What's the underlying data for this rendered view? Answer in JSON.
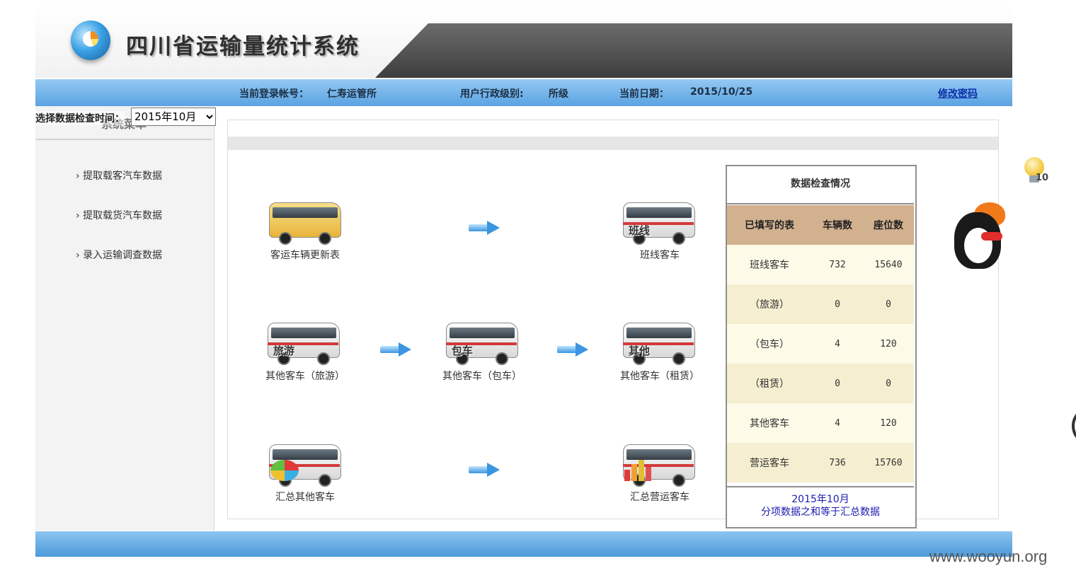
{
  "header": {
    "system_title": "四川省运输量统计系统"
  },
  "infobar": {
    "login_label": "当前登录帐号：",
    "login_value": "仁寿运管所",
    "level_label": "用户行政级别:",
    "level_value": "所级",
    "date_label": "当前日期：",
    "date_value": "2015/10/25",
    "change_password": "修改密码"
  },
  "sidebar": {
    "date_select_label": "选择数据检查时间：",
    "selected_month": "2015年10月",
    "menu_title": "系统菜单",
    "items": [
      {
        "label": "提取载客汽车数据"
      },
      {
        "label": "提取载货汽车数据"
      },
      {
        "label": "录入运输调查数据"
      }
    ]
  },
  "flow": {
    "nodes": [
      {
        "caption": "客运车辆更新表",
        "tag": ""
      },
      {
        "caption": "班线客车",
        "tag": "班线"
      },
      {
        "caption": "其他客车（旅游）",
        "tag": "旅游"
      },
      {
        "caption": "其他客车（包车）",
        "tag": "包车"
      },
      {
        "caption": "其他客车（租赁）",
        "tag": "其他"
      },
      {
        "caption": "汇总其他客车",
        "tag": ""
      },
      {
        "caption": "汇总营运客车",
        "tag": ""
      }
    ]
  },
  "check": {
    "title": "数据检查情况",
    "headers": [
      "已填写的表",
      "车辆数",
      "座位数"
    ],
    "rows": [
      {
        "name": "班线客车",
        "vehicles": "732",
        "seats": "15640"
      },
      {
        "name": "（旅游）",
        "vehicles": "0",
        "seats": "0"
      },
      {
        "name": "（包车）",
        "vehicles": "4",
        "seats": "120"
      },
      {
        "name": "（租赁）",
        "vehicles": "0",
        "seats": "0"
      },
      {
        "name": "其他客车",
        "vehicles": "4",
        "seats": "120"
      },
      {
        "name": "营运客车",
        "vehicles": "736",
        "seats": "15760"
      }
    ],
    "footer_month": "2015年10月",
    "footer_note": "分项数据之和等于汇总数据"
  },
  "widgets": {
    "bulb_count": "10"
  },
  "watermark": "www.wooyun.org",
  "colors": {
    "infobar": "#5aa3e2",
    "table_header": "#d2b18f",
    "link": "#0b2fa8"
  }
}
